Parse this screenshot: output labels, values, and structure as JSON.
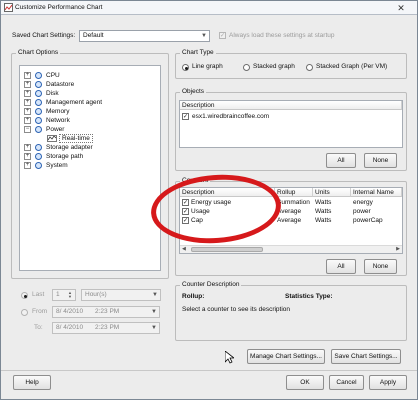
{
  "window": {
    "title": "Customize Performance Chart"
  },
  "saved_settings": {
    "label": "Saved Chart Settings:",
    "value": "Default",
    "always_load_label": "Always load these settings at startup"
  },
  "chart_options": {
    "title": "Chart Options",
    "tree": [
      {
        "label": "CPU",
        "expander": "+"
      },
      {
        "label": "Datastore",
        "expander": "+"
      },
      {
        "label": "Disk",
        "expander": "+"
      },
      {
        "label": "Management agent",
        "expander": "+"
      },
      {
        "label": "Memory",
        "expander": "+"
      },
      {
        "label": "Network",
        "expander": "+"
      },
      {
        "label": "Power",
        "expander": "−"
      },
      {
        "label": "Real-time",
        "selected": true
      },
      {
        "label": "Storage adapter",
        "expander": "+"
      },
      {
        "label": "Storage path",
        "expander": "+"
      },
      {
        "label": "System",
        "expander": "+"
      }
    ]
  },
  "time_range": {
    "last_label": "Last",
    "last_value": "1",
    "last_unit": "Hour(s)",
    "from_label": "From",
    "from_date": "8/ 4/2010",
    "from_time": "2:23 PM",
    "to_label": "To:",
    "to_date": "8/ 4/2010",
    "to_time": "2:23 PM"
  },
  "chart_type": {
    "title": "Chart Type",
    "options": [
      "Line graph",
      "Stacked graph",
      "Stacked Graph (Per VM)"
    ],
    "selected": "Line graph"
  },
  "objects": {
    "title": "Objects",
    "header": "Description",
    "items": [
      {
        "label": "esx1.wiredbraincoffee.com",
        "checked": true
      }
    ],
    "all_label": "All",
    "none_label": "None"
  },
  "counters": {
    "title": "Counters",
    "columns": [
      "Description",
      "Rollup",
      "Units",
      "Internal Name"
    ],
    "rows": [
      {
        "description": "Energy usage",
        "rollup": "Summation",
        "units": "Watts",
        "internal": "energy"
      },
      {
        "description": "Usage",
        "rollup": "Average",
        "units": "Watts",
        "internal": "power"
      },
      {
        "description": "Cap",
        "rollup": "Average",
        "units": "Watts",
        "internal": "powerCap"
      }
    ],
    "all_label": "All",
    "none_label": "None"
  },
  "counter_description": {
    "title": "Counter Description",
    "rollup_label": "Rollup:",
    "stats_label": "Statistics Type:",
    "hint": "Select a counter to see its description"
  },
  "footer": {
    "manage": "Manage Chart Settings...",
    "save": "Save Chart Settings...",
    "help": "Help",
    "ok": "OK",
    "cancel": "Cancel",
    "apply": "Apply"
  },
  "icons": {
    "close": "close-icon",
    "app": "chart-icon",
    "cursor": "mouse-cursor-icon"
  },
  "colors": {
    "annotation": "#d6191b",
    "accent": "#2e64b3"
  }
}
